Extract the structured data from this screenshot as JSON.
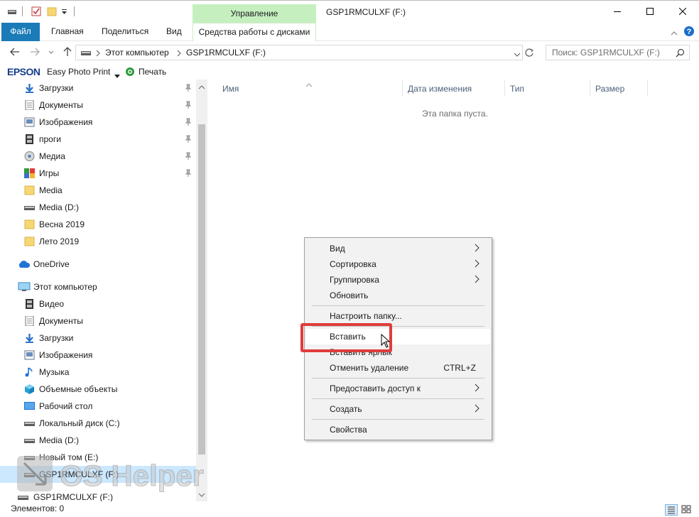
{
  "titlebar": {
    "contextual_tab": "Управление",
    "window_title": "GSP1RMCULXF (F:)"
  },
  "ribbon": {
    "tabs": [
      {
        "label": "Файл"
      },
      {
        "label": "Главная"
      },
      {
        "label": "Поделиться"
      },
      {
        "label": "Вид"
      },
      {
        "label": "Средства работы с дисками"
      }
    ]
  },
  "address": {
    "segments": [
      "Этот компьютер",
      "GSP1RMCULXF (F:)"
    ]
  },
  "search": {
    "placeholder": "Поиск: GSP1RMCULXF (F:)"
  },
  "toolbar": {
    "brand": "EPSON",
    "app": "Easy Photo Print",
    "print": "Печать"
  },
  "nav": {
    "quick_access": [
      {
        "label": "Загрузки",
        "icon": "download-arrow-icon",
        "pinned": true
      },
      {
        "label": "Документы",
        "icon": "document-icon",
        "pinned": true
      },
      {
        "label": "Изображения",
        "icon": "picture-icon",
        "pinned": true
      },
      {
        "label": "проги",
        "icon": "film-folder-icon",
        "pinned": true
      },
      {
        "label": "Медиа",
        "icon": "media-disc-icon",
        "pinned": true
      },
      {
        "label": "Игры",
        "icon": "games-icon",
        "pinned": true
      },
      {
        "label": "Media",
        "icon": "folder-icon",
        "pinned": false
      },
      {
        "label": "Media (D:)",
        "icon": "drive-icon",
        "pinned": false
      },
      {
        "label": "Весна 2019",
        "icon": "folder-icon",
        "pinned": false
      },
      {
        "label": "Лето 2019",
        "icon": "folder-icon",
        "pinned": false
      }
    ],
    "onedrive": "OneDrive",
    "this_pc": "Этот компьютер",
    "this_pc_items": [
      {
        "label": "Видео",
        "icon": "video-icon"
      },
      {
        "label": "Документы",
        "icon": "document-icon"
      },
      {
        "label": "Загрузки",
        "icon": "download-arrow-icon"
      },
      {
        "label": "Изображения",
        "icon": "picture-icon"
      },
      {
        "label": "Музыка",
        "icon": "music-note-icon"
      },
      {
        "label": "Объемные объекты",
        "icon": "cube-icon"
      },
      {
        "label": "Рабочий стол",
        "icon": "desktop-icon"
      },
      {
        "label": "Локальный диск (C:)",
        "icon": "drive-icon"
      },
      {
        "label": "Media (D:)",
        "icon": "drive-icon"
      },
      {
        "label": "Новый том (E:)",
        "icon": "drive-icon"
      },
      {
        "label": "GSP1RMCULXF (F:)",
        "icon": "drive-icon"
      },
      {
        "label": "GSP1RMCULXF (F:)",
        "icon": "drive-icon"
      }
    ]
  },
  "columns": [
    "Имя",
    "Дата изменения",
    "Тип",
    "Размер"
  ],
  "empty_message": "Эта папка пуста.",
  "context_menu": {
    "items": [
      {
        "label": "Вид",
        "submenu": true
      },
      {
        "label": "Сортировка",
        "submenu": true
      },
      {
        "label": "Группировка",
        "submenu": true
      },
      {
        "label": "Обновить",
        "submenu": false
      },
      {
        "label": "Настроить папку...",
        "submenu": false
      },
      {
        "label": "Вставить",
        "submenu": false
      },
      {
        "label": "Вставить ярлык",
        "submenu": false
      },
      {
        "label": "Отменить удаление",
        "shortcut": "CTRL+Z"
      },
      {
        "label": "Предоставить доступ к",
        "submenu": true
      },
      {
        "label": "Создать",
        "submenu": true
      },
      {
        "label": "Свойства",
        "submenu": false
      }
    ]
  },
  "status": {
    "text": "Элементов: 0"
  },
  "watermark": {
    "text": "OS Helper"
  },
  "colors": {
    "file_tab": "#1b7bb8",
    "contextual_tab": "#c6efc0",
    "highlight": "#e03c3c"
  }
}
